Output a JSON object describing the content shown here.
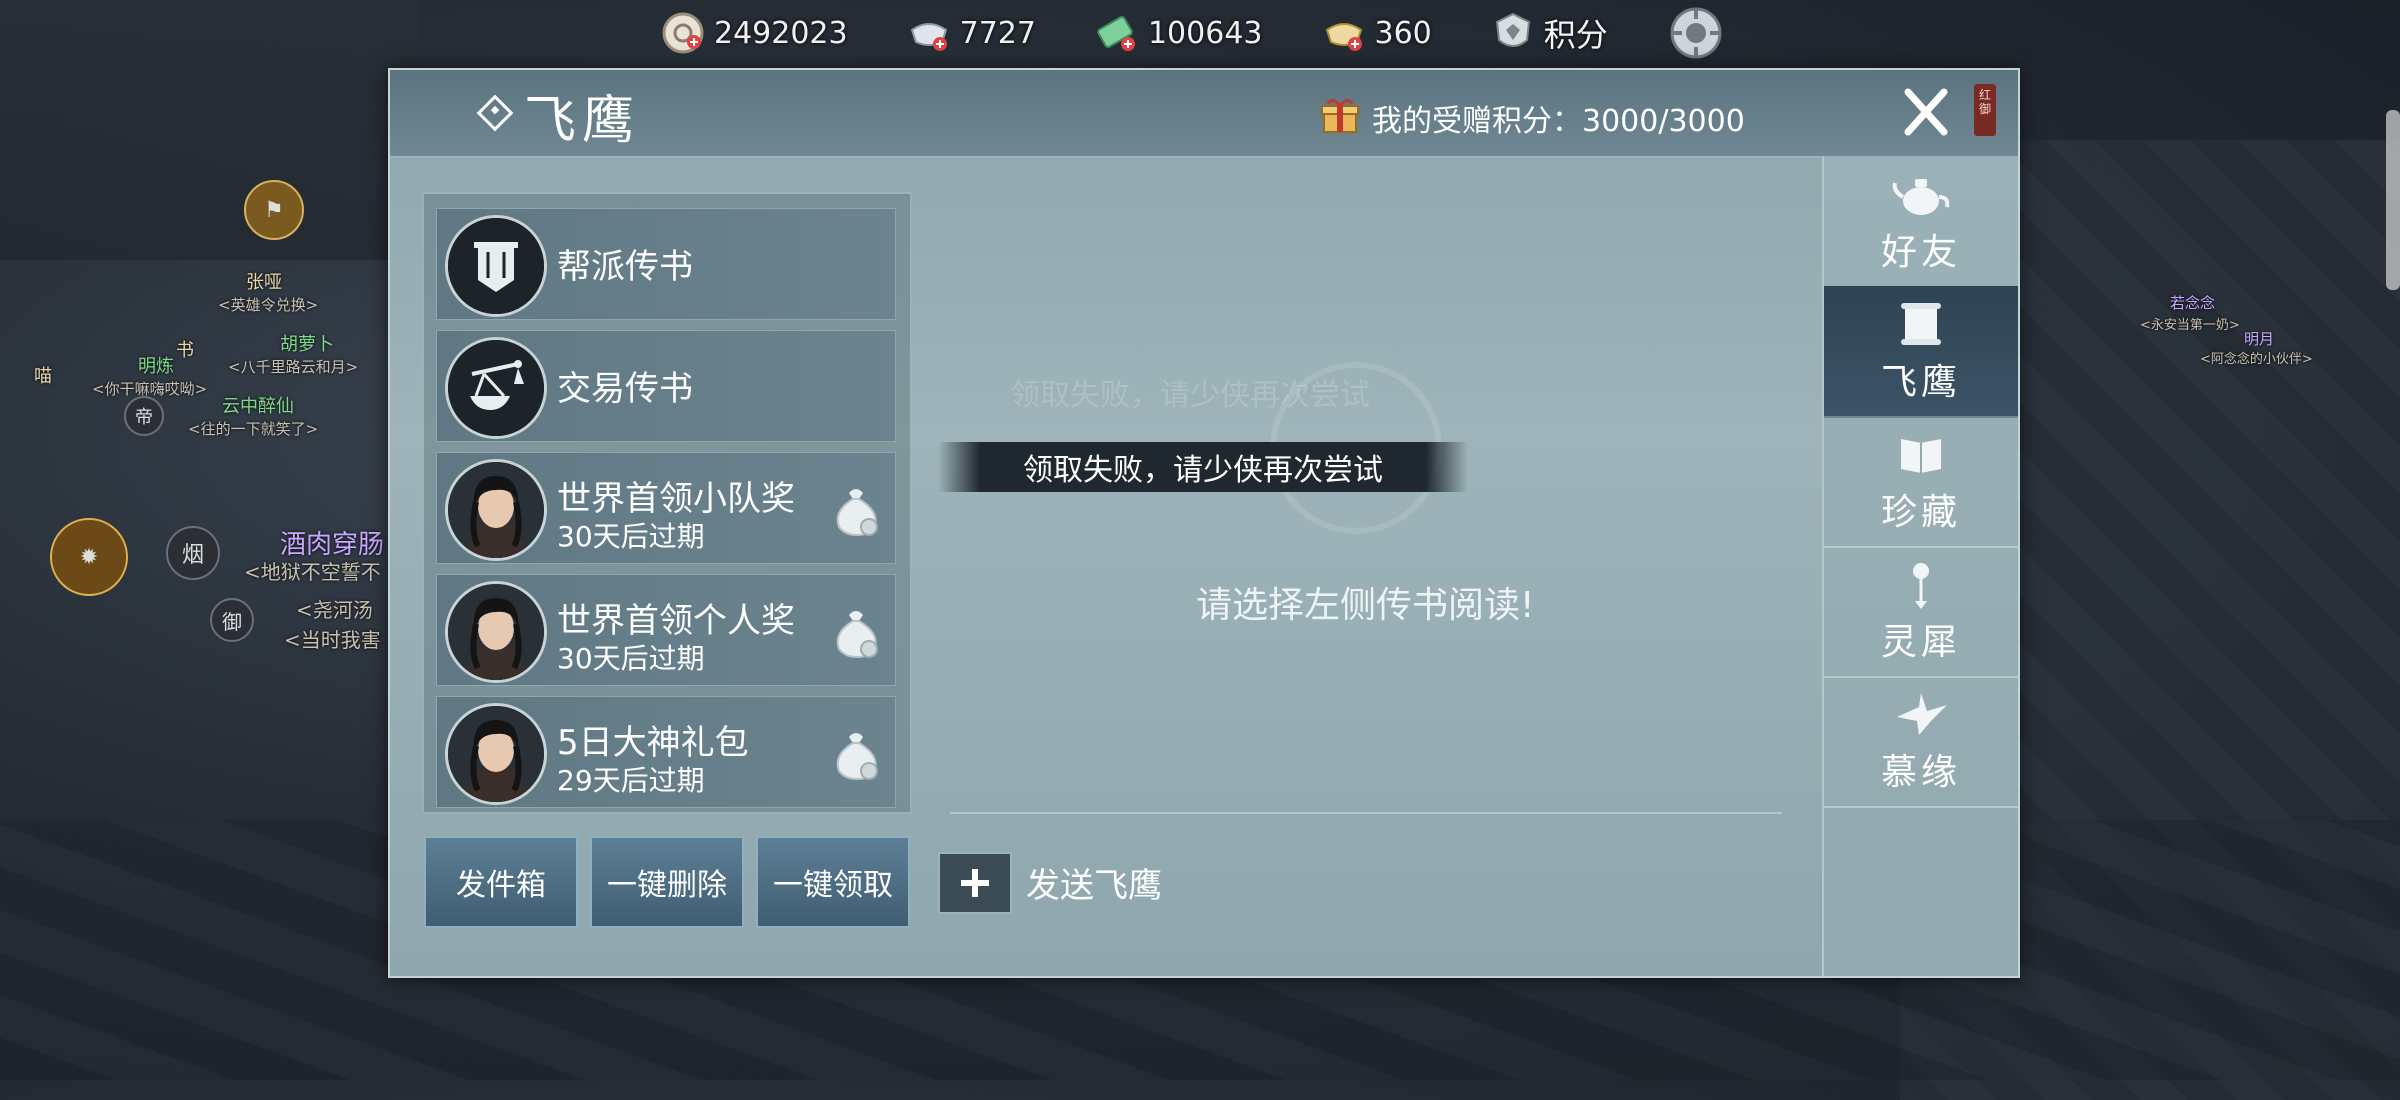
{
  "currencies": [
    {
      "icon": "gold-coin-icon",
      "value": "2492023"
    },
    {
      "icon": "silver-ingot-icon",
      "value": "7727"
    },
    {
      "icon": "banknote-icon",
      "value": "100643"
    },
    {
      "icon": "gold-ingot-icon",
      "value": "360"
    }
  ],
  "points_label": "积分",
  "background_labels": {
    "npc1_name": "张哑",
    "npc1_sub": "<英雄令兑换>",
    "npc2_name": "明炼",
    "npc2_sub": "<你干嘛嗨哎呦>",
    "npc3_name": "胡萝卜",
    "npc3_sub": "<八千里路云和月>",
    "npc4_name": "云中醉仙",
    "npc4_sub": "<往的一下就笑了>",
    "npc5_name": "酒肉穿肠",
    "npc5_sub1": "<地狱不空誓不",
    "npc5_sub2": "<尧河汤",
    "npc5_sub3": "<当时我害",
    "char_shu": "书",
    "char_miao": "喵",
    "char_di": "帝",
    "char_yan": "烟",
    "char_yu": "御",
    "right_name1": "若念念",
    "right_sub1": "<永安当第一奶>",
    "right_name2": "明月",
    "right_sub2": "<阿念念的小伙伴>"
  },
  "dialog": {
    "title": "飞鹰",
    "gift_points_label": "我的受赠积分：3000/3000",
    "seal_text": "红御"
  },
  "mail_list": [
    {
      "title": "帮派传书",
      "expire": "",
      "icon": "guild-banner-icon",
      "has_reward": false
    },
    {
      "title": "交易传书",
      "expire": "",
      "icon": "trade-scale-icon",
      "has_reward": false
    },
    {
      "title": "世界首领小队奖",
      "expire": "30天后过期",
      "icon": "portrait-avatar",
      "has_reward": true
    },
    {
      "title": "世界首领个人奖",
      "expire": "30天后过期",
      "icon": "portrait-avatar",
      "has_reward": true
    },
    {
      "title": "5日大神礼包",
      "expire": "29天后过期",
      "icon": "portrait-avatar",
      "has_reward": true
    }
  ],
  "buttons": {
    "outbox": "发件箱",
    "delete_all": "一键删除",
    "claim_all": "一键领取"
  },
  "toast": "领取失败，请少侠再次尝试",
  "toast_ghost": "领取失败，请少侠再次尝试",
  "placeholder": "请选择左侧传书阅读!",
  "send_label": "发送飞鹰",
  "tabs": [
    {
      "label": "好友",
      "icon": "teapot-icon",
      "active": false
    },
    {
      "label": "飞鹰",
      "icon": "scroll-icon",
      "active": true
    },
    {
      "label": "珍藏",
      "icon": "book-icon",
      "active": false
    },
    {
      "label": "灵犀",
      "icon": "bell-charm-icon",
      "active": false
    },
    {
      "label": "慕缘",
      "icon": "paper-crane-icon",
      "active": false
    }
  ]
}
